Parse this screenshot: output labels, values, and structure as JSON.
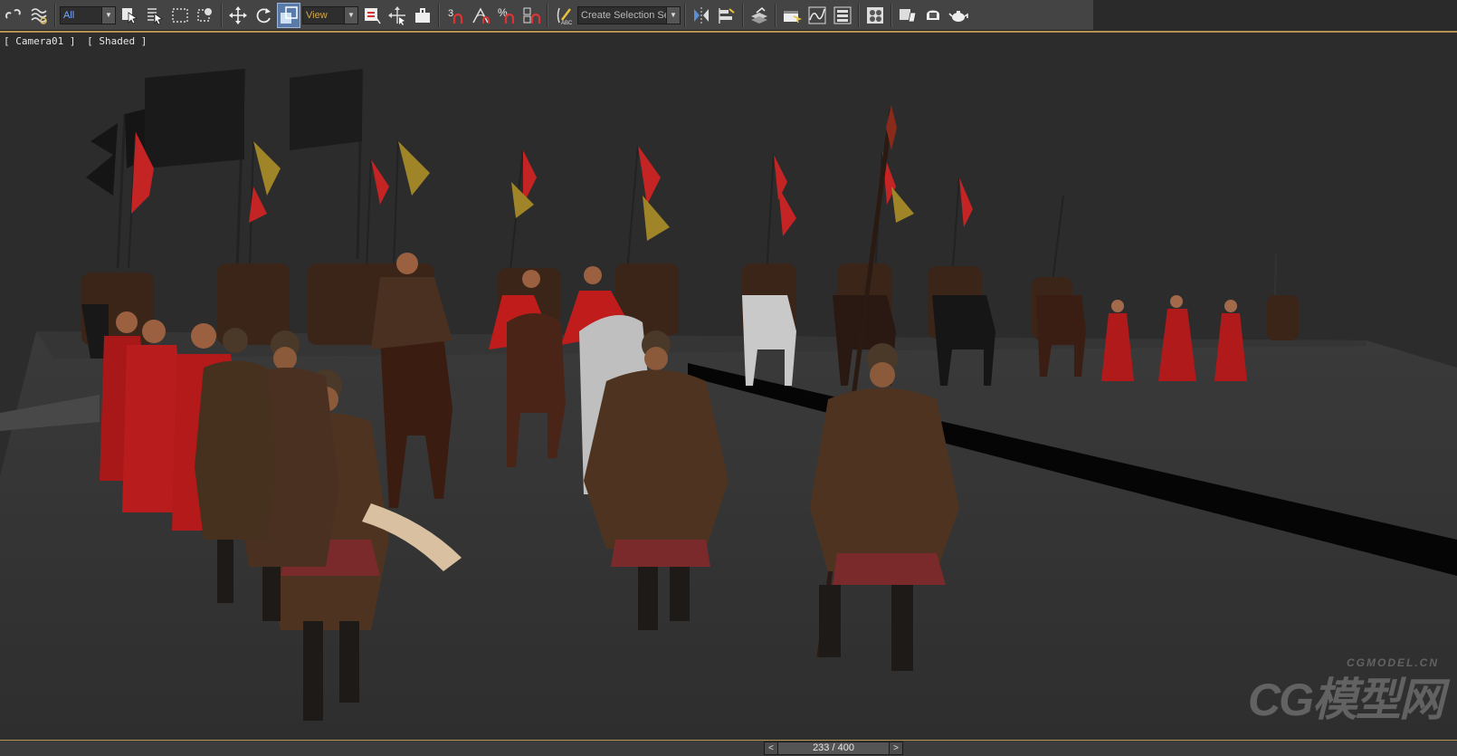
{
  "toolbar": {
    "selection_filter": "All",
    "reference_coordinate": "View",
    "named_selection_set_placeholder": "Create Selection Set",
    "snap_toggle_label": "3",
    "percent_snap_label": "%",
    "icons": [
      "unlink-icon",
      "bind-space-warp-icon",
      "select-object-icon",
      "select-by-name-icon",
      "rectangular-selection-icon",
      "window-crossing-icon",
      "move-icon",
      "rotate-icon",
      "scale-icon",
      "pivot-center-icon",
      "select-manipulate-icon",
      "keyboard-shortcut-icon",
      "angle-snap-icon",
      "percent-snap-icon",
      "spinner-snap-icon",
      "edit-named-selection-icon",
      "mirror-icon",
      "align-icon",
      "layer-manager-icon",
      "ribbon-icon",
      "curve-editor-icon",
      "schematic-view-icon",
      "material-editor-icon",
      "render-setup-icon",
      "rendered-frame-icon",
      "render-teapot-icon"
    ],
    "colors": {
      "bg": "#444444",
      "accent": "#b49150",
      "filter_text": "#7ba6ff",
      "coord_text": "#d4a84b"
    }
  },
  "viewport": {
    "camera_label": "[ Camera01 ]",
    "shading_label": "[ Shaded ]"
  },
  "watermark": {
    "small": "CGMODEL.CN",
    "big": "CG模型网"
  },
  "time_slider": {
    "current_frame": 233,
    "total_frames": 400,
    "display": "233 / 400",
    "prev_label": "<",
    "next_label": ">"
  }
}
